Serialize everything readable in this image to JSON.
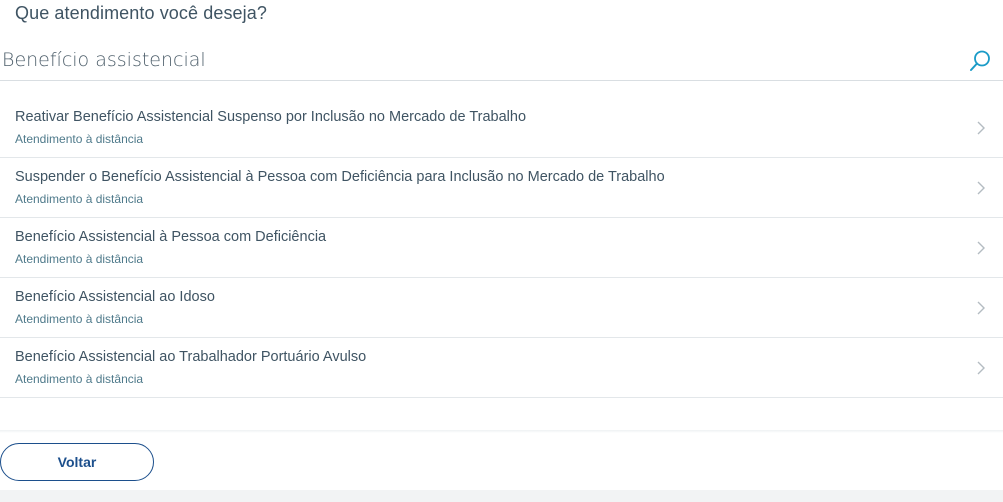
{
  "header": {
    "title": "Que atendimento você deseja?"
  },
  "search": {
    "value": "Benefício assistencial",
    "icon": "search-icon"
  },
  "results": [
    {
      "title": "Reativar Benefício Assistencial Suspenso por Inclusão no Mercado de Trabalho",
      "subtitle": "Atendimento à distância"
    },
    {
      "title": "Suspender o Benefício Assistencial à Pessoa com Deficiência para Inclusão no Mercado de Trabalho",
      "subtitle": "Atendimento à distância"
    },
    {
      "title": "Benefício Assistencial à Pessoa com Deficiência",
      "subtitle": "Atendimento à distância"
    },
    {
      "title": "Benefício Assistencial ao Idoso",
      "subtitle": "Atendimento à distância"
    },
    {
      "title": "Benefício Assistencial ao Trabalhador Portuário Avulso",
      "subtitle": "Atendimento à distância"
    }
  ],
  "footer": {
    "back_label": "Voltar"
  },
  "colors": {
    "text": "#3f5463",
    "subtitle": "#4f7a8b",
    "accent": "#1c4f8c",
    "search_icon": "#1a9bc7",
    "divider": "#e3e7ea"
  }
}
